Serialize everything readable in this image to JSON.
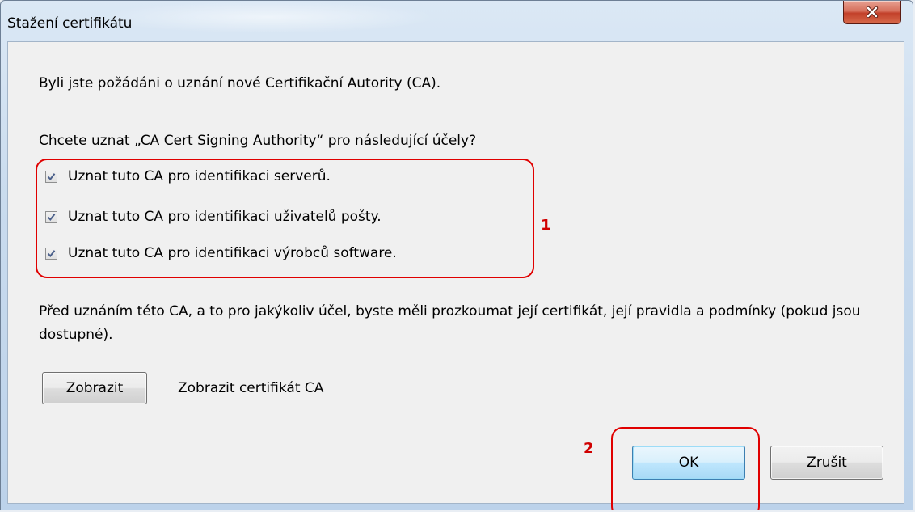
{
  "window": {
    "title": "Stažení certifikátu",
    "close_icon": "close-x-icon"
  },
  "dialog": {
    "intro": "Byli jste požádáni o uznání nové Certifikační Autority (CA).",
    "question": "Chcete uznat „CA Cert Signing Authority“ pro následující účely?",
    "options": [
      {
        "label": "Uznat tuto CA pro identifikaci serverů.",
        "checked": true
      },
      {
        "label": "Uznat tuto CA pro identifikaci uživatelů pošty.",
        "checked": true
      },
      {
        "label": "Uznat tuto CA pro identifikaci výrobců software.",
        "checked": true
      }
    ],
    "advice": "Před uznáním této CA, a to pro jakýkoliv účel, byste měli prozkoumat její certifikát, její pravidla a podmínky (pokud jsou dostupné).",
    "view_button": "Zobrazit",
    "view_label": "Zobrazit certifikát CA",
    "ok_button": "OK",
    "cancel_button": "Zrušit"
  },
  "annotations": {
    "marker_1": "1",
    "marker_2": "2",
    "highlight_color": "#e00000"
  }
}
